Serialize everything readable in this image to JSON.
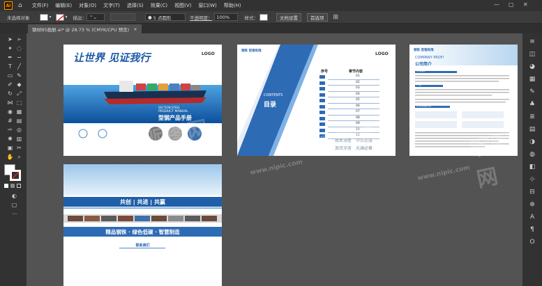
{
  "app": {
    "logo_text": "Ai"
  },
  "menu": {
    "items": [
      "文件(F)",
      "编辑(E)",
      "对象(O)",
      "文字(T)",
      "选择(S)",
      "效果(C)",
      "视图(V)",
      "窗口(W)",
      "帮助(H)"
    ]
  },
  "control": {
    "selection_label": "未选择对象",
    "stroke_label": "描边：",
    "brush_label": "5 点圆形",
    "opacity_label": "不透明度：",
    "opacity_value": "100%",
    "style_label": "样式：",
    "doc_setup": "文档设置",
    "prefs": "首选项"
  },
  "tab": {
    "title": "钢材B5画册.ai* @ 28.73 % (CMYK/CPU 预览)"
  },
  "page1": {
    "headline": "让世界 见证我行",
    "logo": "LOGO",
    "sub_en1": "SECTION STEEL",
    "sub_en2": "PRODUCT MANUAL",
    "sub_cn": "型钢产品手册"
  },
  "page2": {
    "logo": "LOGO",
    "brand": "钢铁 型钢有限",
    "contents_en": "CONTENTS",
    "contents_cn": "目录",
    "col1": "序号",
    "col2": "章节内容",
    "rows": [
      "01",
      "02",
      "03",
      "04",
      "05",
      "06",
      "07",
      "08",
      "09",
      "10",
      "11"
    ],
    "slogan1": "根本洞者　华实必茂",
    "slogan2": "源流深者　光澜必章"
  },
  "page3": {
    "brand": "钢铁 型钢有限",
    "company_en": "COMPANY PROFI",
    "company_cn": "公司简介",
    "section1": "公司简介",
    "section2": "产品",
    "section3": "企业发展历程"
  },
  "page4": {
    "slogan": "共创 | 共进 | 共赢",
    "banner": "精品钢铁 · 绿色低碳 · 智慧制造",
    "contact": "联系我们"
  },
  "watermark": {
    "text": "昵图网",
    "url": "www.nipic.com"
  },
  "colors": {
    "brand_blue": "#1f5fa8",
    "accent": "#2e78c7"
  }
}
